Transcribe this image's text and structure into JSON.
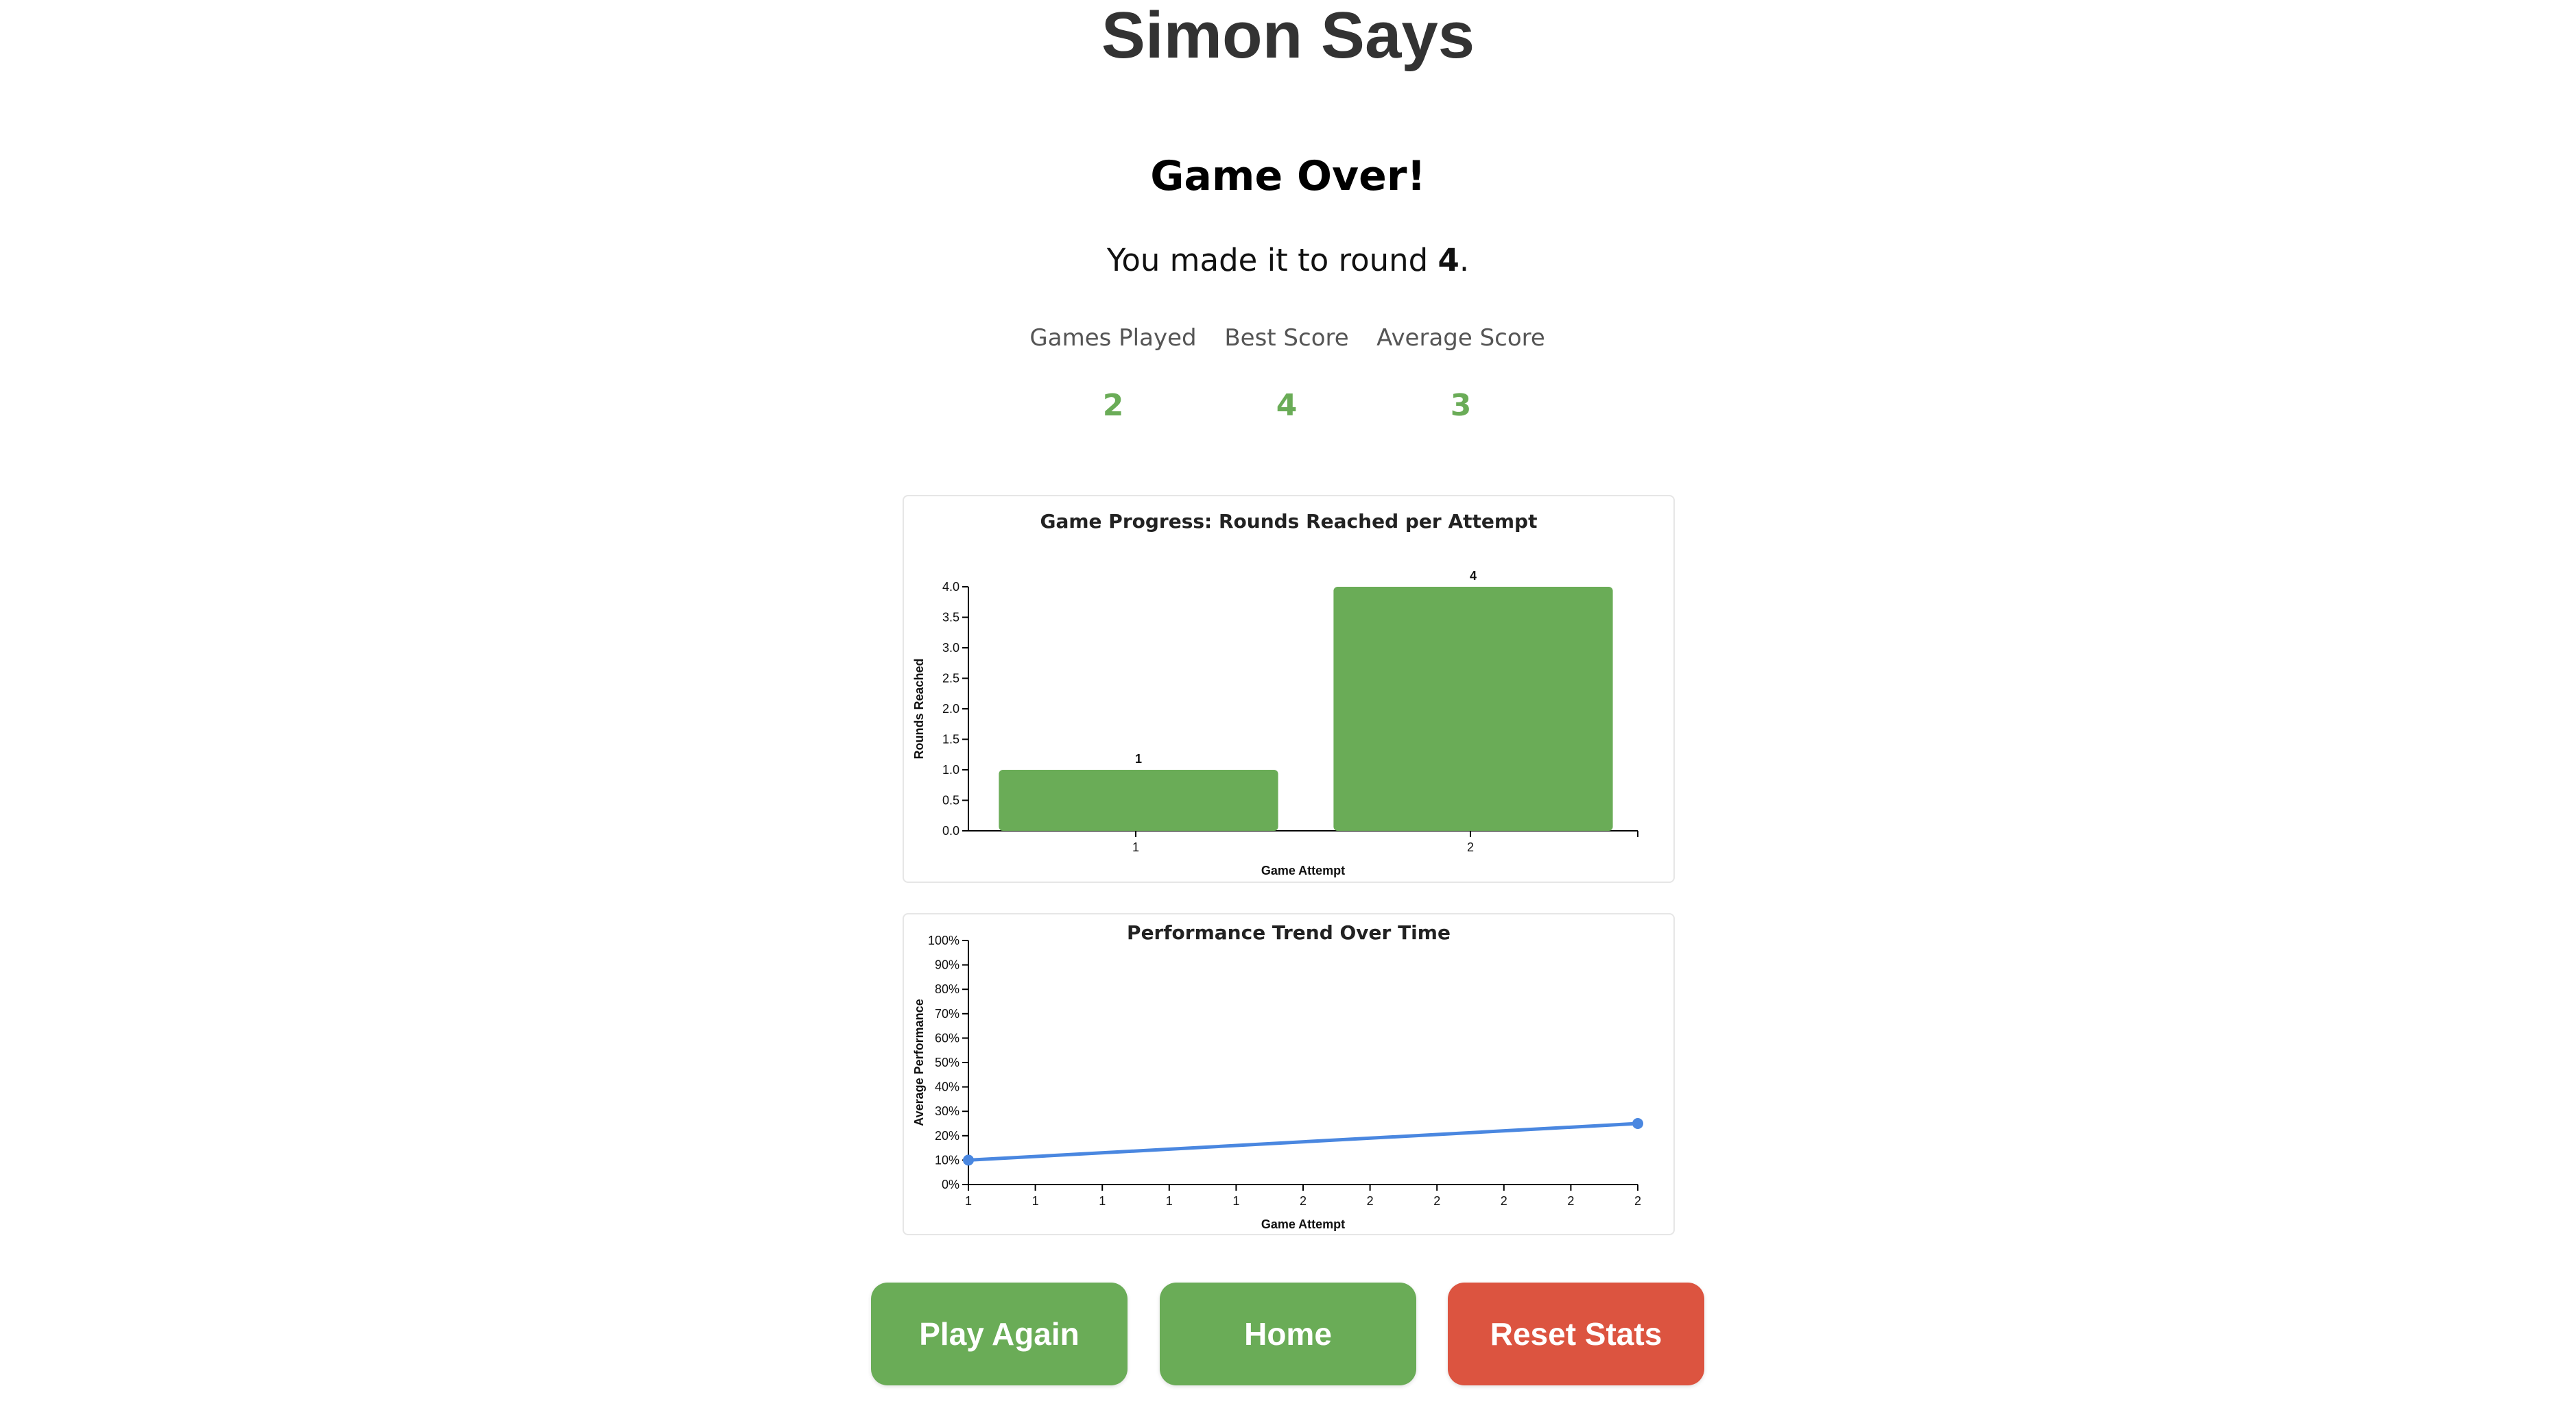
{
  "app": {
    "title": "Simon Says"
  },
  "game_over": {
    "title": "Game Over!",
    "result_prefix": "You made it to round",
    "round": "4",
    "result_suffix": "."
  },
  "stats": [
    {
      "label": "Games Played",
      "value": "2"
    },
    {
      "label": "Best Score",
      "value": "4"
    },
    {
      "label": "Average Score",
      "value": "3"
    }
  ],
  "buttons": {
    "play_again": "Play Again",
    "home": "Home",
    "reset_stats": "Reset Stats"
  },
  "colors": {
    "accent_green": "#6aac57",
    "danger_red": "#dc5440",
    "line_blue": "#4a87e0"
  },
  "chart_data": [
    {
      "type": "bar",
      "title": "Game Progress: Rounds Reached per Attempt",
      "xlabel": "Game Attempt",
      "ylabel": "Rounds Reached",
      "categories": [
        "1",
        "2"
      ],
      "values": [
        1,
        4
      ],
      "data_labels": [
        "1",
        "4"
      ],
      "ylim": [
        0,
        4
      ],
      "y_ticks": [
        "0.0",
        "0.5",
        "1.0",
        "1.5",
        "2.0",
        "2.5",
        "3.0",
        "3.5",
        "4.0"
      ],
      "y_tick_values": [
        0,
        0.5,
        1,
        1.5,
        2,
        2.5,
        3,
        3.5,
        4
      ],
      "color": "#6aac57",
      "grid": false
    },
    {
      "type": "line",
      "title": "Performance Trend Over Time",
      "xlabel": "Game Attempt",
      "ylabel": "Average Performance",
      "x": [
        1,
        2
      ],
      "y": [
        10,
        25
      ],
      "xlim": [
        1,
        2
      ],
      "ylim": [
        0,
        100
      ],
      "y_ticks": [
        "0%",
        "10%",
        "20%",
        "30%",
        "40%",
        "50%",
        "60%",
        "70%",
        "80%",
        "90%",
        "100%"
      ],
      "y_tick_values": [
        0,
        10,
        20,
        30,
        40,
        50,
        60,
        70,
        80,
        90,
        100
      ],
      "x_ticks": [
        "1",
        "1",
        "1",
        "1",
        "1",
        "2",
        "2",
        "2",
        "2",
        "2",
        "2"
      ],
      "x_tick_values": [
        1,
        1.1,
        1.2,
        1.3,
        1.4,
        1.5,
        1.6,
        1.7,
        1.8,
        1.9,
        2
      ],
      "color": "#4a87e0",
      "grid": false
    }
  ]
}
